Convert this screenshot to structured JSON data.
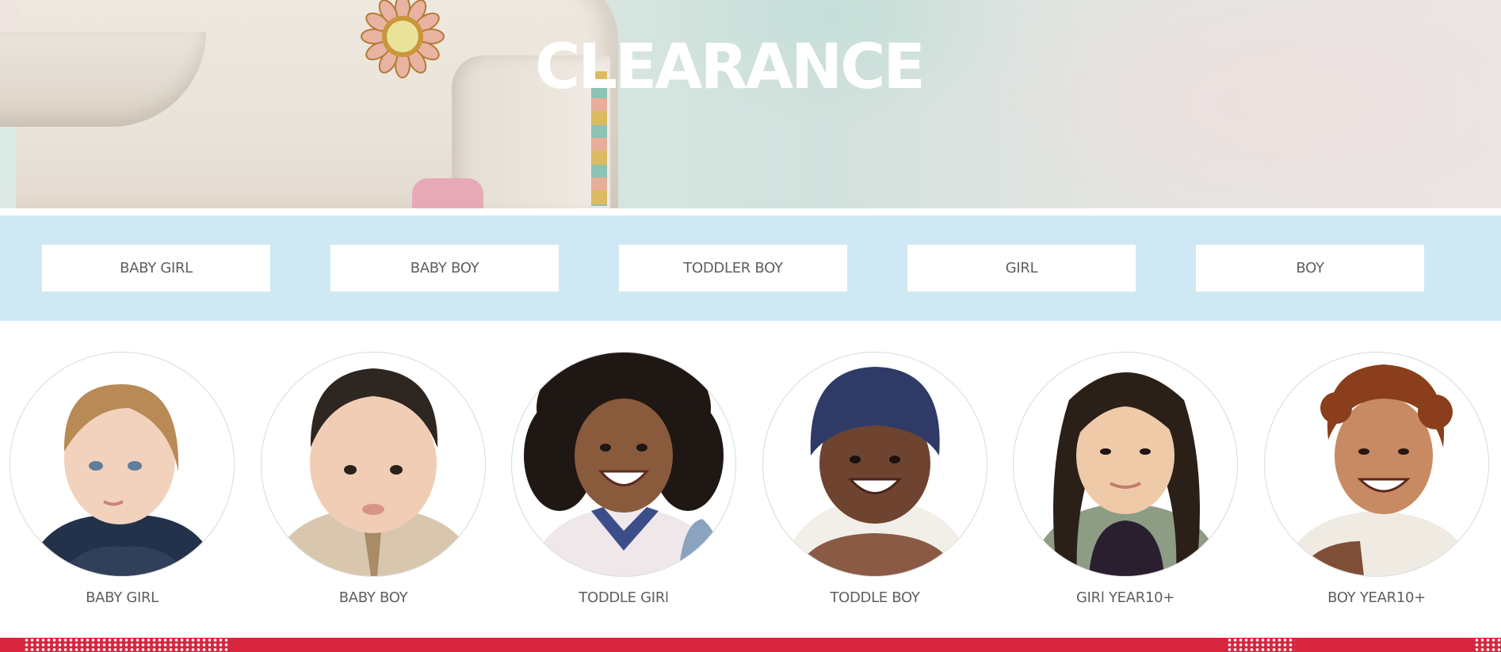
{
  "hero": {
    "title": "CLEARANCE"
  },
  "category_buttons": [
    {
      "label": "BABY GIRL"
    },
    {
      "label": "BABY BOY"
    },
    {
      "label": "TODDLER BOY"
    },
    {
      "label": "GIRL"
    },
    {
      "label": "BOY"
    }
  ],
  "circle_categories": [
    {
      "label": "BABY GIRL"
    },
    {
      "label": "BABY BOY"
    },
    {
      "label": "TODDLE GIRl"
    },
    {
      "label": "TODDLE BOY"
    },
    {
      "label": "GIRl YEAR10+"
    },
    {
      "label": "BOY YEAR10+"
    }
  ],
  "colors": {
    "band_background": "#cfe9f4",
    "button_text": "#5f5f5f",
    "footer_red": "#d8263f"
  }
}
